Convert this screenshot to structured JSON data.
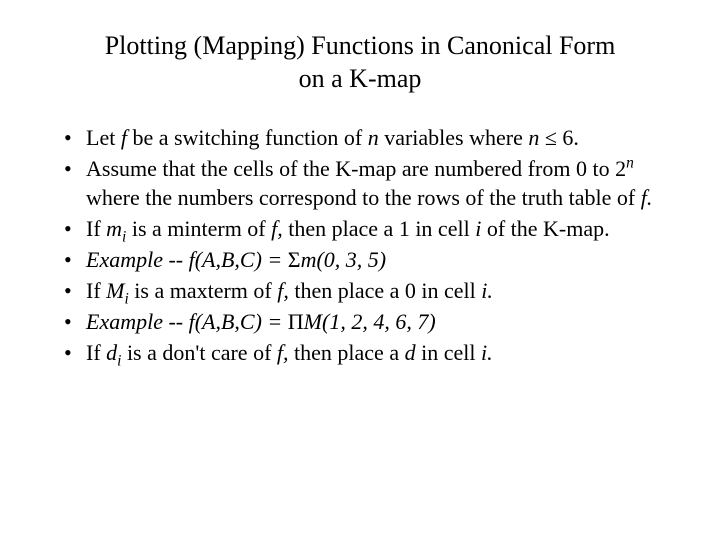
{
  "title_line1": "Plotting (Mapping) Functions in Canonical Form",
  "title_line2": "on a K-map",
  "bullets": {
    "b1": {
      "pre": "Let ",
      "f": "f",
      "mid": " be a switching function of ",
      "n1": "n",
      "mid2": " variables where ",
      "n2": "n",
      "post": " ≤ 6."
    },
    "b2": {
      "pre": "Assume that the cells of the K-map are numbered from 0 to 2",
      "sup": "n",
      "mid": " where the numbers correspond to the rows of the truth table of ",
      "f": "f.",
      "post": ""
    },
    "b3": {
      "pre": "If ",
      "m": "m",
      "sub": "i",
      "mid": " is a minterm of ",
      "f": "f,",
      "mid2": " then place a 1 in cell ",
      "i": "i",
      "post": " of the K-map."
    },
    "b4": {
      "ex": "Example -- f(A,B,C) = ",
      "sym": "Σ",
      "tail": "m(0, 3, 5)"
    },
    "b5": {
      "pre": "If ",
      "m": "M",
      "sub": "i",
      "mid": " is a maxterm of ",
      "f": "f,",
      "mid2": " then place a 0 in cell ",
      "i": "i.",
      "post": ""
    },
    "b6": {
      "ex": "Example -- f(A,B,C) = ",
      "sym": "Π",
      "tail": "M(1, 2, 4, 6, 7)"
    },
    "b7": {
      "pre": "If ",
      "d": "d",
      "sub": "i",
      "mid": " is a don't care of ",
      "f": "f,",
      "mid2": " then place a ",
      "d2": "d",
      "mid3": " in cell ",
      "i": "i.",
      "post": ""
    }
  }
}
